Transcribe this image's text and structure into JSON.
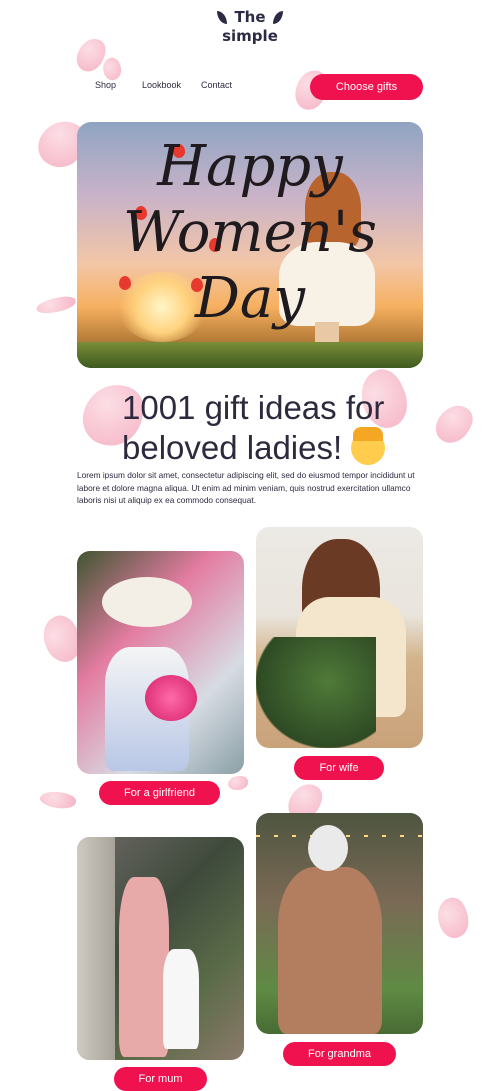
{
  "brand": {
    "line1": "The",
    "line2": "simple"
  },
  "nav": {
    "shop": "Shop",
    "lookbook": "Lookbook",
    "contact": "Contact"
  },
  "cta": {
    "choose_gifts": "Choose gifts"
  },
  "hero": {
    "script_line1": "Happy",
    "script_line2": "Women's",
    "script_line3": "Day"
  },
  "headline": {
    "text": "1001 gift ideas for beloved ladies!"
  },
  "intro": {
    "paragraph": "Lorem ipsum dolor sit amet, consectetur adipiscing elit, sed do eiusmod tempor incididunt ut labore et dolore magna aliqua. Ut enim ad minim veniam, quis nostrud exercitation ullamco laboris nisi ut aliquip ex ea commodo consequat."
  },
  "cards": {
    "girlfriend": "For a girlfriend",
    "wife": "For wife",
    "mum": "For mum",
    "grandma": "For grandma"
  },
  "colors": {
    "accent": "#f0114f",
    "text": "#2d2a3e",
    "petal": "#f29ab1"
  }
}
